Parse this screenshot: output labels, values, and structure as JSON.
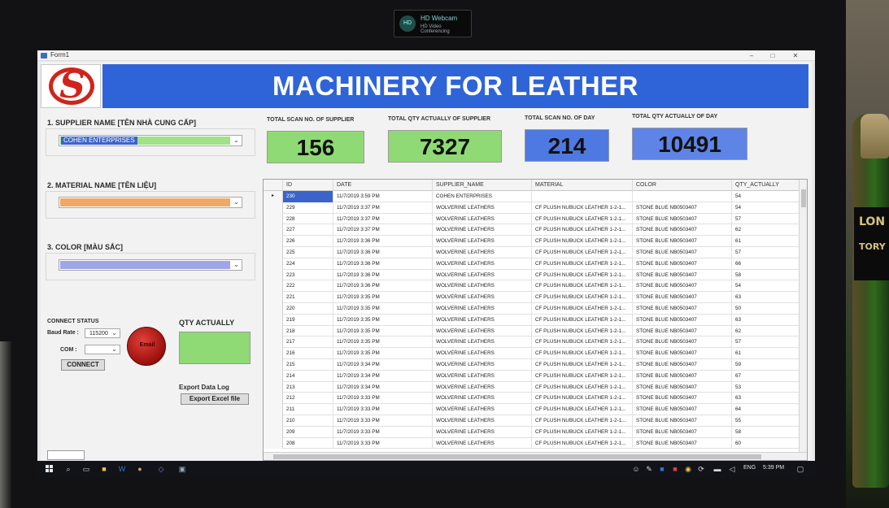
{
  "webcam": {
    "line1": "HD Webcam",
    "line2": "HD Video Conferencing"
  },
  "backdrop": {
    "label_a": "LON",
    "label_b": "TORY"
  },
  "window": {
    "title": "Form1",
    "minimize": "–",
    "maximize": "□",
    "close": "✕"
  },
  "header": {
    "title": "MACHINERY FOR LEATHER",
    "logo": "S",
    "brand_color": "#2f64d9",
    "logo_color": "#d0241b"
  },
  "supplier": {
    "label": "1. SUPPLIER NAME [TÊN NHÀ CUNG CẤP]",
    "value": "COHEN ENTERPRISES",
    "color": "#9fe289"
  },
  "material": {
    "label": "2. MATERIAL NAME [TÊN LIỆU]",
    "value": "",
    "color": "#f0a865"
  },
  "color_select": {
    "label": "3. COLOR [MÀU SẮC]",
    "value": "",
    "color": "#9fa6e8"
  },
  "stats": [
    {
      "label": "TOTAL SCAN NO. OF SUPPLIER",
      "value": "156",
      "color": "#8fda74"
    },
    {
      "label": "TOTAL QTY ACTUALLY OF SUPPLIER",
      "value": "7327",
      "color": "#8fda74"
    },
    {
      "label": "TOTAL SCAN NO. OF DAY",
      "value": "214",
      "color": "#4f79e2"
    },
    {
      "label": "TOTAL QTY ACTUALLY OF DAY",
      "value": "10491",
      "color": "#5e84e6"
    }
  ],
  "connect": {
    "title": "CONNECT STATUS",
    "baud_label": "Baud Rate :",
    "baud_value": "115200",
    "com_label": "COM :",
    "com_value": "",
    "button": "CONNECT",
    "led_label": "Email"
  },
  "qty": {
    "label": "QTY ACTUALLY"
  },
  "export": {
    "label": "Export Data Log",
    "button": "Export Excel file"
  },
  "bottom_button": "button3",
  "grid": {
    "columns": [
      "ID",
      "DATE",
      "SUPPLIER_NAME",
      "MATERIAL",
      "COLOR",
      "QTY_ACTUALLY"
    ],
    "rows": [
      [
        "230",
        "11/7/2019 3:59 PM",
        "COHEN ENTERPRISES",
        "",
        "",
        "54"
      ],
      [
        "229",
        "11/7/2019 3:37 PM",
        "WOLVERINE LEATHERS",
        "CF PLUSH NUBUCK LEATHER 1-2-1...",
        "STONE BLUE NB0503407",
        "54"
      ],
      [
        "228",
        "11/7/2019 3:37 PM",
        "WOLVERINE LEATHERS",
        "CF PLUSH NUBUCK LEATHER 1-2-1...",
        "STONE BLUE NB0503407",
        "57"
      ],
      [
        "227",
        "11/7/2019 3:37 PM",
        "WOLVERINE LEATHERS",
        "CF PLUSH NUBUCK LEATHER 1-2-1...",
        "STONE BLUE NB0503407",
        "62"
      ],
      [
        "226",
        "11/7/2019 3:36 PM",
        "WOLVERINE LEATHERS",
        "CF PLUSH NUBUCK LEATHER 1-2-1...",
        "STONE BLUE NB0503407",
        "61"
      ],
      [
        "225",
        "11/7/2019 3:36 PM",
        "WOLVERINE LEATHERS",
        "CF PLUSH NUBUCK LEATHER 1-2-1...",
        "STONE BLUE NB0503407",
        "57"
      ],
      [
        "224",
        "11/7/2019 3:36 PM",
        "WOLVERINE LEATHERS",
        "CF PLUSH NUBUCK LEATHER 1-2-1...",
        "STONE BLUE NB0503407",
        "66"
      ],
      [
        "223",
        "11/7/2019 3:36 PM",
        "WOLVERINE LEATHERS",
        "CF PLUSH NUBUCK LEATHER 1-2-1...",
        "STONE BLUE NB0503407",
        "58"
      ],
      [
        "222",
        "11/7/2019 3:36 PM",
        "WOLVERINE LEATHERS",
        "CF PLUSH NUBUCK LEATHER 1-2-1...",
        "STONE BLUE NB0503407",
        "54"
      ],
      [
        "221",
        "11/7/2019 3:35 PM",
        "WOLVERINE LEATHERS",
        "CF PLUSH NUBUCK LEATHER 1-2-1...",
        "STONE BLUE NB0503407",
        "63"
      ],
      [
        "220",
        "11/7/2019 3:35 PM",
        "WOLVERINE LEATHERS",
        "CF PLUSH NUBUCK LEATHER 1-2-1...",
        "STONE BLUE NB0503407",
        "50"
      ],
      [
        "219",
        "11/7/2019 3:35 PM",
        "WOLVERINE LEATHERS",
        "CF PLUSH NUBUCK LEATHER 1-2-1...",
        "STONE BLUE NB0503407",
        "63"
      ],
      [
        "218",
        "11/7/2019 3:35 PM",
        "WOLVERINE LEATHERS",
        "CF PLUSH NUBUCK LEATHER 1-2-1...",
        "STONE BLUE NB0503407",
        "62"
      ],
      [
        "217",
        "11/7/2019 3:35 PM",
        "WOLVERINE LEATHERS",
        "CF PLUSH NUBUCK LEATHER 1-2-1...",
        "STONE BLUE NB0503407",
        "57"
      ],
      [
        "216",
        "11/7/2019 3:35 PM",
        "WOLVERINE LEATHERS",
        "CF PLUSH NUBUCK LEATHER 1-2-1...",
        "STONE BLUE NB0503407",
        "61"
      ],
      [
        "215",
        "11/7/2019 3:34 PM",
        "WOLVERINE LEATHERS",
        "CF PLUSH NUBUCK LEATHER 1-2-1...",
        "STONE BLUE NB0503407",
        "59"
      ],
      [
        "214",
        "11/7/2019 3:34 PM",
        "WOLVERINE LEATHERS",
        "CF PLUSH NUBUCK LEATHER 1-2-1...",
        "STONE BLUE NB0503407",
        "67"
      ],
      [
        "213",
        "11/7/2019 3:34 PM",
        "WOLVERINE LEATHERS",
        "CF PLUSH NUBUCK LEATHER 1-2-1...",
        "STONE BLUE NB0503407",
        "53"
      ],
      [
        "212",
        "11/7/2019 3:33 PM",
        "WOLVERINE LEATHERS",
        "CF PLUSH NUBUCK LEATHER 1-2-1...",
        "STONE BLUE NB0503407",
        "63"
      ],
      [
        "211",
        "11/7/2019 3:33 PM",
        "WOLVERINE LEATHERS",
        "CF PLUSH NUBUCK LEATHER 1-2-1...",
        "STONE BLUE NB0503407",
        "64"
      ],
      [
        "210",
        "11/7/2019 3:33 PM",
        "WOLVERINE LEATHERS",
        "CF PLUSH NUBUCK LEATHER 1-2-1...",
        "STONE BLUE NB0503407",
        "55"
      ],
      [
        "209",
        "11/7/2019 3:33 PM",
        "WOLVERINE LEATHERS",
        "CF PLUSH NUBUCK LEATHER 1-2-1...",
        "STONE BLUE NB0503407",
        "58"
      ],
      [
        "208",
        "11/7/2019 3:33 PM",
        "WOLVERINE LEATHERS",
        "CF PLUSH NUBUCK LEATHER 1-2-1...",
        "STONE BLUE NB0503407",
        "60"
      ]
    ],
    "selected_row": 0,
    "row_marker": "▸"
  },
  "taskbar": {
    "icons": [
      "search-icon",
      "task-view-icon",
      "edge-icon",
      "file-explorer-icon",
      "word-icon",
      "app-icon",
      "visual-studio-icon",
      "form-app-icon"
    ],
    "tray_icons": [
      "people-icon",
      "pen-icon",
      "store-icon",
      "pdf-icon",
      "chrome-icon",
      "sync-icon",
      "network-icon",
      "volume-icon"
    ],
    "language": "ENG",
    "clock": "5:39 PM"
  }
}
